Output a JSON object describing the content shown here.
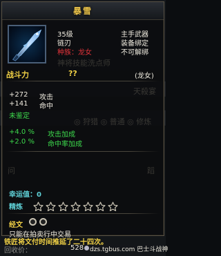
{
  "tooltip": {
    "title": "暴雪",
    "level": "35级",
    "weapon_type": "链刃",
    "race_label": "种族：龙女",
    "slot": "主手武器",
    "bind": "装备绑定",
    "repair": "不可解绑",
    "combat_label": "战斗力",
    "combat_value": "??",
    "race_tag": "(龙女)",
    "stats": [
      {
        "value": "+272",
        "name": "攻击"
      },
      {
        "value": "+141",
        "name": "命中"
      }
    ],
    "unidentified": "未鉴定",
    "bonus": [
      {
        "value": "+4.0 %",
        "name": "攻击加成"
      },
      {
        "value": "+2.0 %",
        "name": "命中率加成"
      }
    ],
    "luck_label": "幸运值：0",
    "refine_label": "精炼",
    "refine_stars": 0,
    "refine_max": 7,
    "inscription_label": "经文",
    "trade_note": "只能在拍卖行中交易",
    "lore": "铁匠将文付时间推延了二十四次。"
  },
  "background": {
    "ghost_npc": "神将技能洗点师",
    "ghost_tab": "天殺宴",
    "ghost_modes": "◎ 狩猎  ◎ 普通  ◎ 修炼",
    "ghost_left": "问",
    "ghost_right": "蹈"
  },
  "footer": {
    "label": "回收价：",
    "price": "528",
    "watermark": "dzs.tgbus.com 巴士斗战神"
  },
  "colors": {
    "title": "#e9c24a",
    "red": "#e0333a",
    "green": "#3dd84c",
    "yellow": "#f2d246",
    "lore": "#f2d246"
  }
}
